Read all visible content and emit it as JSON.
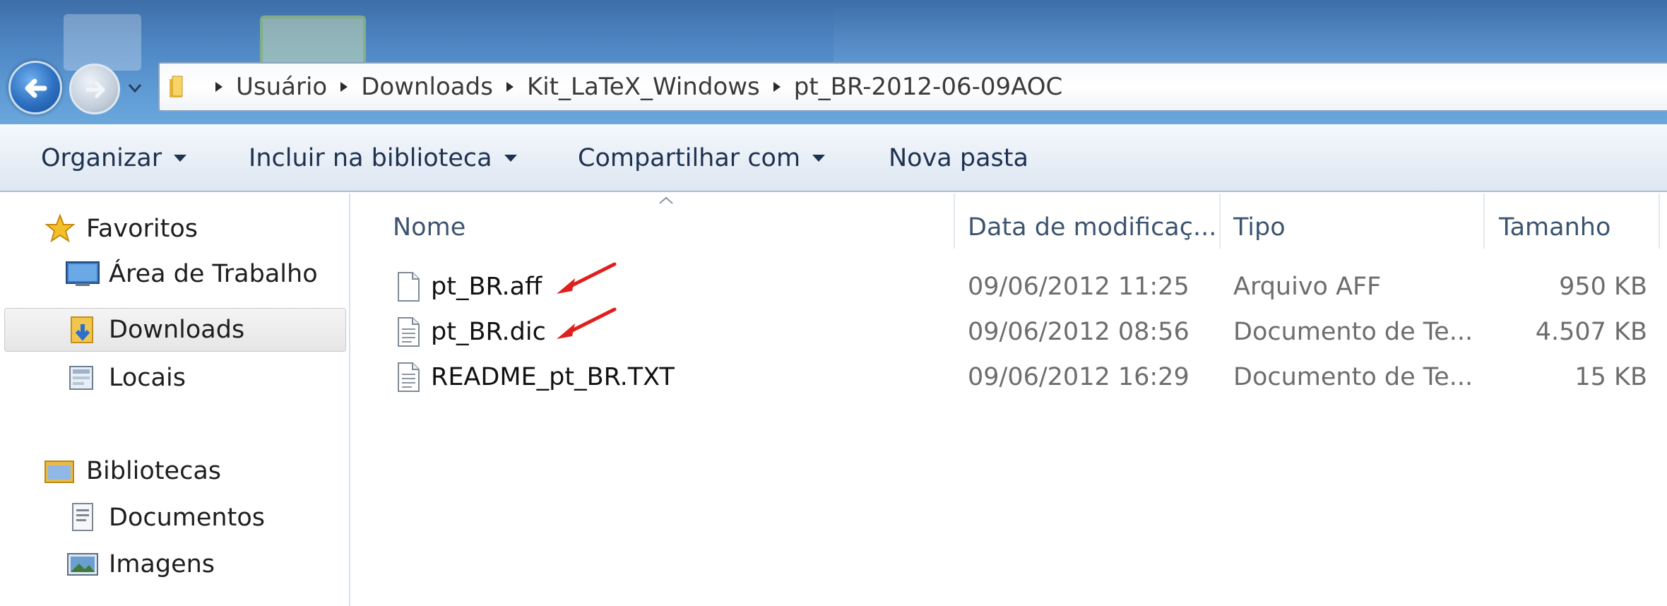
{
  "address_bar": {
    "breadcrumbs": [
      "Usuário",
      "Downloads",
      "Kit_LaTeX_Windows",
      "pt_BR-2012-06-09AOC"
    ]
  },
  "toolbar": {
    "organize_label": "Organizar",
    "include_library_label": "Incluir na biblioteca",
    "share_label": "Compartilhar com",
    "new_folder_label": "Nova pasta"
  },
  "sidebar": {
    "favorites": {
      "label": "Favoritos",
      "items": [
        {
          "label": "Área de Trabalho",
          "icon": "desktop-icon"
        },
        {
          "label": "Downloads",
          "icon": "downloads-folder-icon",
          "selected": true
        },
        {
          "label": "Locais",
          "icon": "recent-places-icon"
        }
      ]
    },
    "libraries": {
      "label": "Bibliotecas",
      "items": [
        {
          "label": "Documentos",
          "icon": "documents-icon"
        },
        {
          "label": "Imagens",
          "icon": "pictures-icon"
        }
      ]
    }
  },
  "file_list": {
    "columns": {
      "name": "Nome",
      "modified": "Data de modificaç...",
      "type": "Tipo",
      "size": "Tamanho"
    },
    "rows": [
      {
        "name": "pt_BR.aff",
        "modified": "09/06/2012 11:25",
        "type": "Arquivo AFF",
        "size": "950 KB",
        "icon": "blank-file-icon",
        "highlighted": true
      },
      {
        "name": "pt_BR.dic",
        "modified": "09/06/2012 08:56",
        "type": "Documento de Te...",
        "size": "4.507 KB",
        "icon": "text-file-icon",
        "highlighted": true
      },
      {
        "name": "README_pt_BR.TXT",
        "modified": "09/06/2012 16:29",
        "type": "Documento de Te...",
        "size": "15 KB",
        "icon": "text-file-icon",
        "highlighted": false
      }
    ]
  },
  "colors": {
    "annotation_arrow": "#e0201c",
    "title_band": "#4d86c3",
    "toolbar_text": "#1e3250"
  }
}
